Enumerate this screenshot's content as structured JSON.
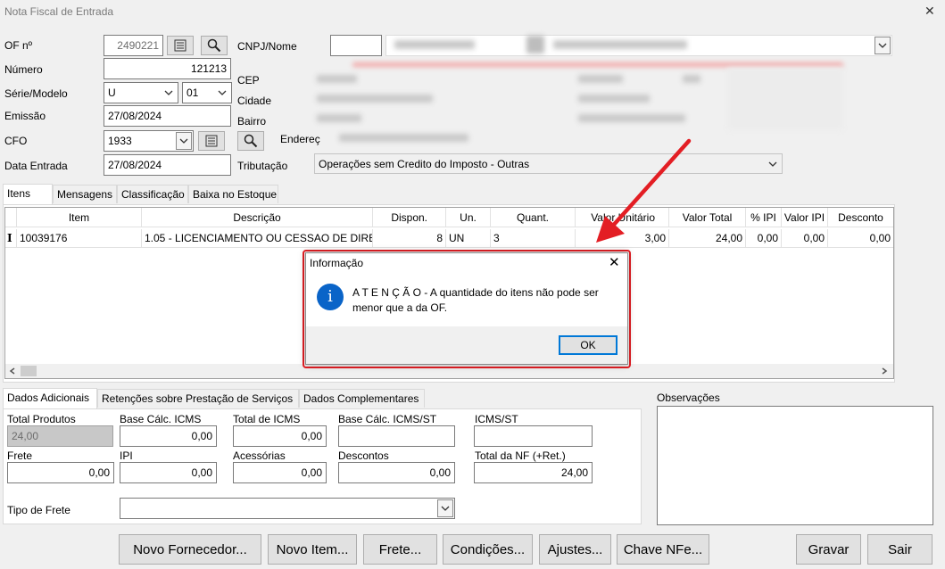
{
  "window": {
    "title": "Nota Fiscal de Entrada",
    "close": "✕"
  },
  "header": {
    "of_label": "OF nº",
    "of_value": "2490221",
    "numero_label": "Número",
    "numero_value": "121213",
    "serie_label": "Série/Modelo",
    "serie_value": "U",
    "modelo_value": "01",
    "emissao_label": "Emissão",
    "emissao_value": "27/08/2024",
    "cfo_label": "CFO",
    "cfo_value": "1933",
    "data_entrada_label": "Data Entrada",
    "data_entrada_value": "27/08/2024",
    "cnpj_label": "CNPJ/Nome",
    "cep_label": "CEP",
    "cidade_label": "Cidade",
    "bairro_label": "Bairro",
    "endereco_label": "Endereç",
    "tributacao_label": "Tributação",
    "tributacao_value": "Operações sem Credito do Imposto - Outras"
  },
  "tabs": [
    "Itens",
    "Mensagens",
    "Classificação",
    "Baixa no Estoque"
  ],
  "grid": {
    "columns": [
      "Item",
      "Descrição",
      "Dispon.",
      "Un.",
      "Quant.",
      "Valor Unitário",
      "Valor Total",
      "% IPI",
      "Valor IPI",
      "Desconto"
    ],
    "rows": [
      {
        "marker": "I",
        "item": "10039176",
        "descricao": "1.05 - LICENCIAMENTO OU CESSAO DE DIREI",
        "dispon": "8",
        "un": "UN",
        "quant": "3",
        "valor_unitario": "3,00",
        "valor_total": "24,00",
        "pct_ipi": "0,00",
        "valor_ipi": "0,00",
        "desconto": "0,00"
      }
    ]
  },
  "dialog": {
    "title": "Informação",
    "message_line1": "A T E N Ç Ã O - A quantidade do itens não pode ser",
    "message_line2": "menor que a da OF.",
    "ok_label": "OK",
    "info_glyph": "i",
    "close": "✕"
  },
  "bottom_tabs": [
    "Dados Adicionais",
    "Retenções sobre Prestação de Serviços",
    "Dados Complementares"
  ],
  "totals": {
    "total_produtos_label": "Total Produtos",
    "total_produtos_value": "24,00",
    "base_icms_label": "Base Cálc. ICMS",
    "base_icms_value": "0,00",
    "total_icms_label": "Total de ICMS",
    "total_icms_value": "0,00",
    "base_icms_st_label": "Base Cálc. ICMS/ST",
    "base_icms_st_value": "",
    "icms_st_label": "ICMS/ST",
    "icms_st_value": "",
    "frete_label": "Frete",
    "frete_value": "0,00",
    "ipi_label": "IPI",
    "ipi_value": "0,00",
    "acessorias_label": "Acessórias",
    "acessorias_value": "0,00",
    "descontos_label": "Descontos",
    "descontos_value": "0,00",
    "total_nf_label": "Total da NF (+Ret.)",
    "total_nf_value": "24,00",
    "tipo_frete_label": "Tipo de Frete",
    "tipo_frete_value": ""
  },
  "observacoes_label": "Observações",
  "buttons": {
    "novo_fornecedor": "Novo Fornecedor...",
    "novo_item": "Novo Item...",
    "frete": "Frete...",
    "condicoes": "Condições...",
    "ajustes": "Ajustes...",
    "chave_nfe": "Chave NFe...",
    "gravar": "Gravar",
    "sair": "Sair"
  },
  "colors": {
    "accent_red": "#e31e24",
    "info_blue": "#0a64c8",
    "focus_blue": "#0078d7"
  }
}
